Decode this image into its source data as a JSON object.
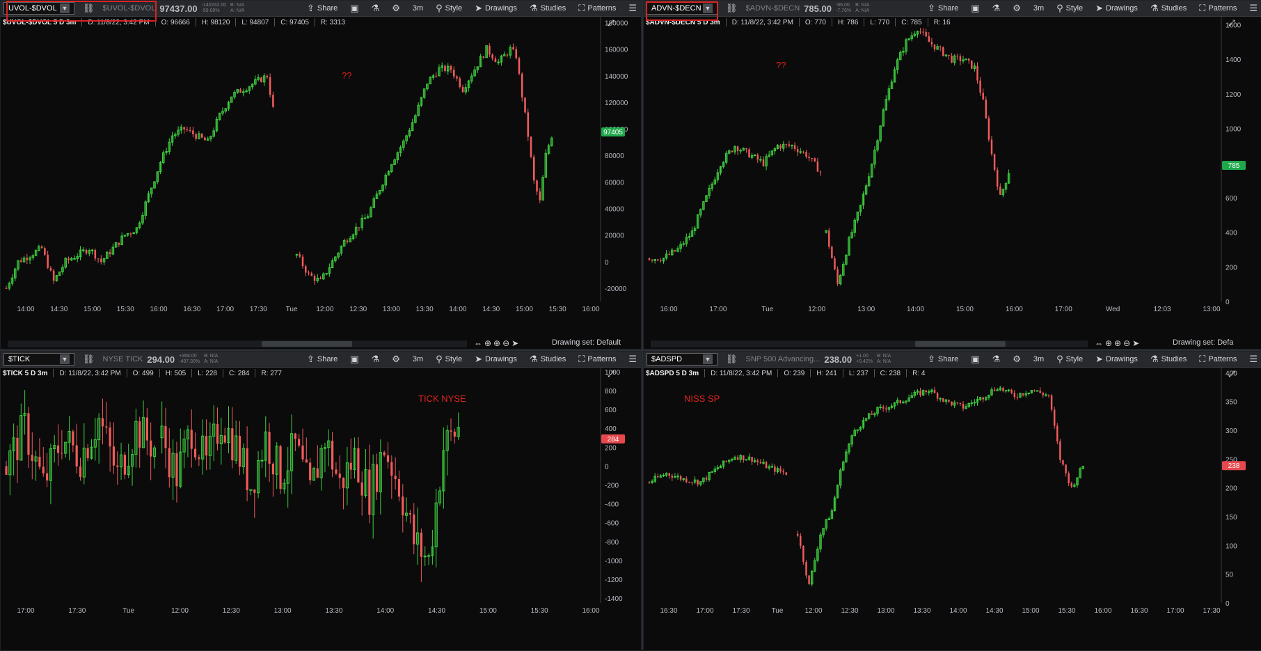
{
  "panels": [
    {
      "id": "uvol",
      "symbol": "UVOL-$DVOL",
      "description": "$UVOL-$DVOL",
      "last": "97437.00",
      "change": "-140242.00",
      "change_pct": "-59.00%",
      "bid": "B: N/A",
      "ask": "A: N/A",
      "info_symbol": "$UVOL-$DVOL 5 D 3m",
      "info_date": "D: 11/8/22, 3:42 PM",
      "info_open": "O: 96666",
      "info_high": "H: 98120",
      "info_low": "L: 94807",
      "info_close": "C: 97405",
      "info_range": "R: 3313",
      "annotation": "??",
      "price_badge": "97405",
      "price_badge_color": "#1fa84a",
      "drawing_set": "Drawing set: Default"
    },
    {
      "id": "advn",
      "symbol": "ADVN-$DECN",
      "description": "$ADVN-$DECN",
      "last": "785.00",
      "change": "-66.00",
      "change_pct": "-7.76%",
      "bid": "B: N/A",
      "ask": "A: N/A",
      "info_symbol": "$ADVN-$DECN 5 D 3m",
      "info_date": "D: 11/8/22, 3:42 PM",
      "info_open": "O: 770",
      "info_high": "H: 786",
      "info_low": "L: 770",
      "info_close": "C: 785",
      "info_range": "R: 16",
      "annotation": "??",
      "price_badge": "785",
      "price_badge_color": "#1fa84a",
      "drawing_set": "Drawing set: Defa"
    },
    {
      "id": "tick",
      "symbol": "$TICK",
      "description": "NYSE TICK",
      "last": "294.00",
      "change": "+368.00",
      "change_pct": "-497.30%",
      "bid": "B: N/A",
      "ask": "A: N/A",
      "info_symbol": "$TICK 5 D 3m",
      "info_date": "D: 11/8/22, 3:42 PM",
      "info_open": "O: 499",
      "info_high": "H: 505",
      "info_low": "L: 228",
      "info_close": "C: 284",
      "info_range": "R: 277",
      "annotation": "TICK NYSE",
      "price_badge": "284",
      "price_badge_color": "#e5484d",
      "drawing_set": ""
    },
    {
      "id": "adspd",
      "symbol": "$ADSPD",
      "description": "SNP 500 Advancing...",
      "last": "238.00",
      "change": "+1.00",
      "change_pct": "+0.42%",
      "bid": "B: N/A",
      "ask": "A: N/A",
      "info_symbol": "$ADSPD 5 D 3m",
      "info_date": "D: 11/8/22, 3:42 PM",
      "info_open": "O: 239",
      "info_high": "H: 241",
      "info_low": "L: 237",
      "info_close": "C: 238",
      "info_range": "R: 4",
      "annotation": "NISS SP",
      "price_badge": "238",
      "price_badge_color": "#e5484d",
      "drawing_set": ""
    }
  ],
  "toolbar": {
    "share": "Share",
    "timeframe": "3m",
    "style": "Style",
    "drawings": "Drawings",
    "studies": "Studies",
    "patterns": "Patterns"
  },
  "colors": {
    "up": "#3ecf3e",
    "down": "#f25b5b",
    "background": "#0b0b0c",
    "annotation": "#e1251b"
  },
  "chart_data": [
    {
      "type": "candlestick",
      "panel": "uvol",
      "y_ticks": [
        180000,
        160000,
        140000,
        120000,
        100000,
        80000,
        60000,
        40000,
        20000,
        0,
        -20000
      ],
      "ylim": [
        -30000,
        185000
      ],
      "x_ticks": [
        "14:00",
        "14:30",
        "15:00",
        "15:30",
        "16:00",
        "16:30",
        "17:00",
        "17:30",
        "Tue",
        "12:00",
        "12:30",
        "13:00",
        "13:30",
        "14:00",
        "14:30",
        "15:00",
        "15:30",
        "16:00"
      ],
      "path_day1": [
        [
          0,
          -20000
        ],
        [
          4,
          0
        ],
        [
          8,
          5000
        ],
        [
          12,
          10000
        ],
        [
          16,
          -15000
        ],
        [
          20,
          0
        ],
        [
          24,
          5000
        ],
        [
          28,
          10000
        ],
        [
          32,
          0
        ],
        [
          36,
          10000
        ],
        [
          40,
          20000
        ],
        [
          44,
          25000
        ],
        [
          48,
          50000
        ],
        [
          52,
          75000
        ],
        [
          56,
          95000
        ],
        [
          60,
          100000
        ],
        [
          64,
          95000
        ],
        [
          68,
          90000
        ],
        [
          72,
          110000
        ],
        [
          76,
          125000
        ],
        [
          80,
          130000
        ],
        [
          84,
          135000
        ],
        [
          88,
          140000
        ],
        [
          90,
          115000
        ]
      ],
      "path_day2": [
        [
          98,
          5000
        ],
        [
          102,
          -10000
        ],
        [
          106,
          -15000
        ],
        [
          110,
          0
        ],
        [
          114,
          15000
        ],
        [
          118,
          25000
        ],
        [
          122,
          35000
        ],
        [
          126,
          55000
        ],
        [
          130,
          75000
        ],
        [
          134,
          90000
        ],
        [
          138,
          110000
        ],
        [
          142,
          135000
        ],
        [
          146,
          145000
        ],
        [
          150,
          145000
        ],
        [
          154,
          130000
        ],
        [
          158,
          145000
        ],
        [
          162,
          160000
        ],
        [
          166,
          150000
        ],
        [
          170,
          160000
        ],
        [
          172,
          155000
        ],
        [
          176,
          95000
        ],
        [
          178,
          60000
        ],
        [
          180,
          45000
        ],
        [
          182,
          80000
        ],
        [
          184,
          95000
        ]
      ],
      "x_max": 200
    },
    {
      "type": "candlestick",
      "panel": "advn",
      "y_ticks": [
        1600,
        1400,
        1200,
        1000,
        800,
        600,
        400,
        200,
        0
      ],
      "ylim": [
        0,
        1650
      ],
      "x_ticks": [
        "16:00",
        "17:00",
        "Tue",
        "12:00",
        "13:00",
        "14:00",
        "15:00",
        "16:00",
        "17:00",
        "Wed",
        "12:03",
        "13:00"
      ],
      "path_day1": [
        [
          0,
          250
        ],
        [
          5,
          250
        ],
        [
          10,
          300
        ],
        [
          15,
          400
        ],
        [
          20,
          600
        ],
        [
          25,
          800
        ],
        [
          30,
          900
        ],
        [
          35,
          850
        ],
        [
          40,
          800
        ],
        [
          45,
          900
        ],
        [
          50,
          900
        ],
        [
          55,
          850
        ],
        [
          60,
          750
        ]
      ],
      "path_day2": [
        [
          62,
          400
        ],
        [
          66,
          100
        ],
        [
          70,
          350
        ],
        [
          74,
          550
        ],
        [
          78,
          800
        ],
        [
          82,
          1100
        ],
        [
          86,
          1350
        ],
        [
          90,
          1500
        ],
        [
          94,
          1580
        ],
        [
          98,
          1500
        ],
        [
          102,
          1450
        ],
        [
          106,
          1400
        ],
        [
          110,
          1400
        ],
        [
          114,
          1350
        ],
        [
          117,
          1150
        ],
        [
          120,
          850
        ],
        [
          123,
          600
        ],
        [
          126,
          750
        ]
      ],
      "x_max": 200
    },
    {
      "type": "candlestick",
      "panel": "tick",
      "y_ticks": [
        1000,
        800,
        600,
        400,
        200,
        0,
        -200,
        -400,
        -600,
        -800,
        -1000,
        -1200,
        -1400
      ],
      "ylim": [
        -1450,
        1050
      ],
      "x_ticks": [
        "17:00",
        "17:30",
        "Tue",
        "12:00",
        "12:30",
        "13:00",
        "13:30",
        "14:00",
        "14:30",
        "15:00",
        "15:30",
        "16:00"
      ],
      "path_day1": [
        [
          0,
          0
        ],
        [
          5,
          400
        ],
        [
          10,
          -200
        ],
        [
          15,
          300
        ],
        [
          20,
          100
        ],
        [
          25,
          500
        ],
        [
          30,
          -100
        ],
        [
          35,
          400
        ],
        [
          40,
          200
        ]
      ],
      "path_day2": [
        [
          42,
          300
        ],
        [
          46,
          -100
        ],
        [
          50,
          400
        ],
        [
          54,
          0
        ],
        [
          58,
          500
        ],
        [
          62,
          200
        ],
        [
          66,
          -200
        ],
        [
          70,
          300
        ],
        [
          74,
          -100
        ],
        [
          78,
          200
        ],
        [
          82,
          -300
        ],
        [
          86,
          300
        ],
        [
          90,
          -200
        ],
        [
          94,
          100
        ],
        [
          98,
          -300
        ],
        [
          102,
          200
        ],
        [
          106,
          -200
        ],
        [
          110,
          -800
        ],
        [
          114,
          -1000
        ],
        [
          118,
          200
        ],
        [
          122,
          400
        ]
      ],
      "x_max": 160
    },
    {
      "type": "candlestick",
      "panel": "adspd",
      "y_ticks": [
        400,
        350,
        300,
        250,
        200,
        150,
        100,
        50,
        0
      ],
      "ylim": [
        0,
        410
      ],
      "x_ticks": [
        "16:30",
        "17:00",
        "17:30",
        "Tue",
        "12:00",
        "12:30",
        "13:00",
        "13:30",
        "14:00",
        "14:30",
        "15:00",
        "15:30",
        "16:00",
        "16:30",
        "17:00",
        "17:30"
      ],
      "path_day1": [
        [
          0,
          210
        ],
        [
          6,
          225
        ],
        [
          12,
          215
        ],
        [
          18,
          210
        ],
        [
          24,
          235
        ],
        [
          30,
          255
        ],
        [
          36,
          250
        ],
        [
          42,
          235
        ],
        [
          48,
          225
        ]
      ],
      "path_day2": [
        [
          52,
          120
        ],
        [
          56,
          30
        ],
        [
          60,
          120
        ],
        [
          64,
          160
        ],
        [
          68,
          250
        ],
        [
          72,
          300
        ],
        [
          76,
          320
        ],
        [
          80,
          335
        ],
        [
          86,
          345
        ],
        [
          92,
          360
        ],
        [
          98,
          370
        ],
        [
          104,
          350
        ],
        [
          110,
          340
        ],
        [
          116,
          355
        ],
        [
          122,
          375
        ],
        [
          128,
          360
        ],
        [
          134,
          370
        ],
        [
          140,
          360
        ],
        [
          144,
          250
        ],
        [
          148,
          200
        ],
        [
          150,
          220
        ],
        [
          152,
          238
        ]
      ],
      "x_max": 200
    }
  ]
}
